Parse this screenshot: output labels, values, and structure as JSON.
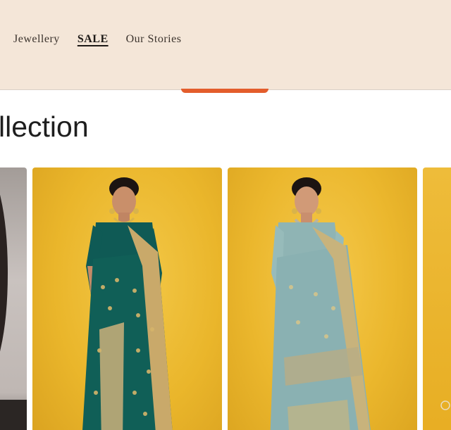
{
  "nav": {
    "items": [
      {
        "label": "Jewellery",
        "active": false
      },
      {
        "label": "SALE",
        "active": true
      },
      {
        "label": "Our Stories",
        "active": false
      }
    ]
  },
  "section": {
    "title": "llection"
  },
  "products": [
    {
      "image": "partial product photo with dark mirror frame"
    },
    {
      "image": "model in teal green brocade saree on yellow background"
    },
    {
      "image": "model in pale blue silk saree on yellow background"
    },
    {
      "image": "partial product photo on yellow background"
    }
  ],
  "colors": {
    "header_bg": "#f4e6d8",
    "accent": "#e35d2c",
    "text": "#1e1e1e",
    "card_bg": "#eab62b"
  }
}
